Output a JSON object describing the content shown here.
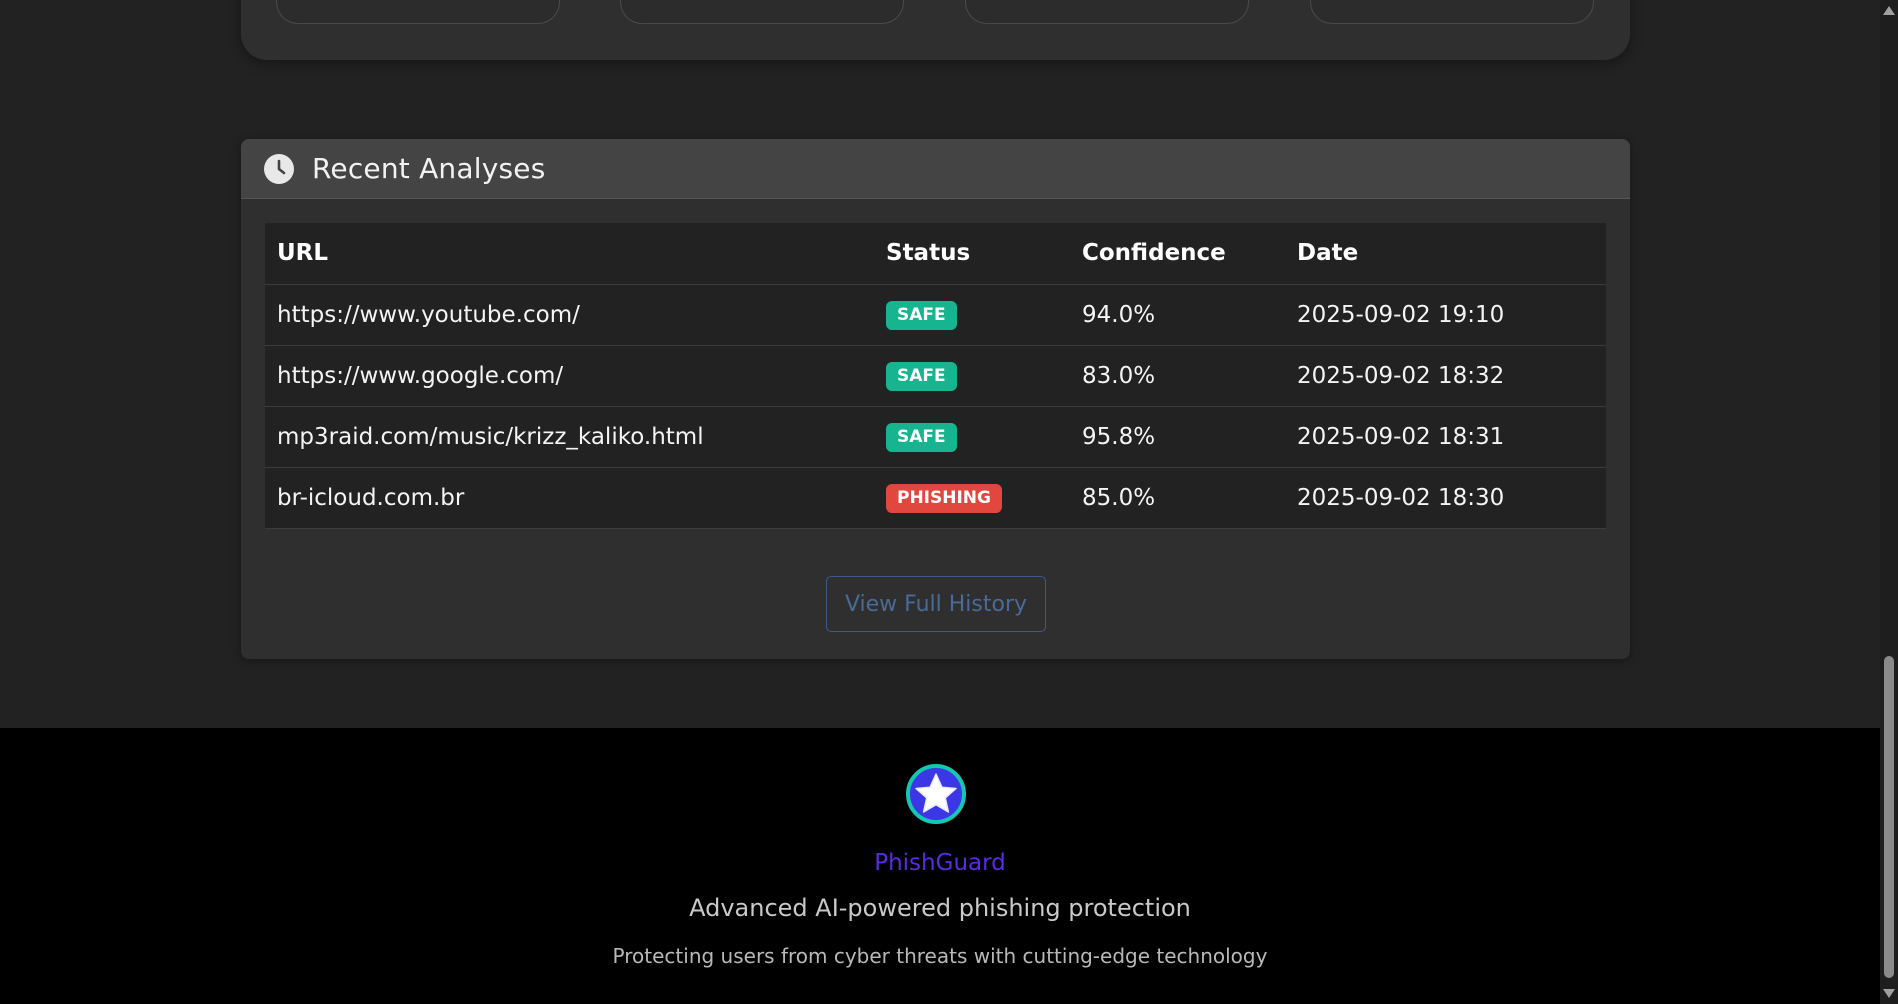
{
  "recent": {
    "title": "Recent Analyses",
    "columns": {
      "url": "URL",
      "status": "Status",
      "confidence": "Confidence",
      "date": "Date"
    },
    "rows": [
      {
        "url": "https://www.youtube.com/",
        "status": "SAFE",
        "confidence": "94.0%",
        "date": "2025-09-02 19:10"
      },
      {
        "url": "https://www.google.com/",
        "status": "SAFE",
        "confidence": "83.0%",
        "date": "2025-09-02 18:32"
      },
      {
        "url": "mp3raid.com/music/krizz_kaliko.html",
        "status": "SAFE",
        "confidence": "95.8%",
        "date": "2025-09-02 18:31"
      },
      {
        "url": "br-icloud.com.br",
        "status": "PHISHING",
        "confidence": "85.0%",
        "date": "2025-09-02 18:30"
      }
    ],
    "history_button": "View Full History"
  },
  "footer": {
    "brand": "PhishGuard",
    "tagline": "Advanced AI-powered phishing protection",
    "subline": "Protecting users from cyber threats with cutting-edge technology"
  },
  "icons": {
    "header": "clock-icon",
    "logo": "star-icon"
  },
  "colors": {
    "safe": "#17b58f",
    "phishing": "#e2473f",
    "brand": "#5a2be6",
    "logo_ring": "#16c7b0",
    "logo_fill": "#3b36e6"
  }
}
